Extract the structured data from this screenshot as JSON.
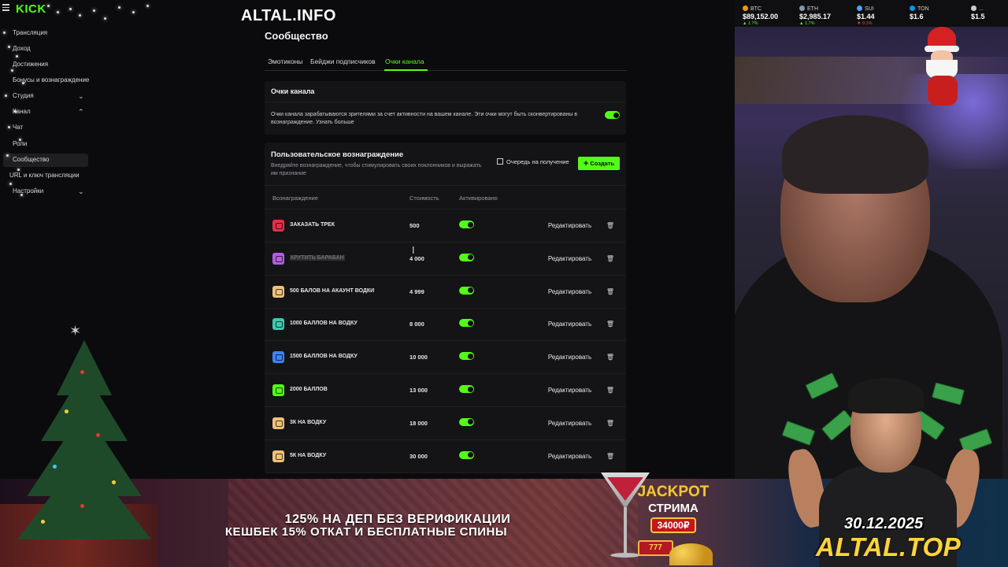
{
  "sidebar": {
    "logo": "KICK",
    "items": [
      {
        "label": "Трансляция"
      },
      {
        "label": "Доход"
      },
      {
        "label": "Достижения"
      },
      {
        "label": "Бонусы и вознаграждение"
      },
      {
        "label": "Студия"
      },
      {
        "label": "Канал"
      },
      {
        "label": "Чат"
      },
      {
        "label": "Роли"
      },
      {
        "label": "Сообщество"
      },
      {
        "label": "URL и ключ трансляции"
      },
      {
        "label": "Настройки"
      }
    ]
  },
  "header": {
    "site": "ALTAL.INFO"
  },
  "page": {
    "title": "Сообщество"
  },
  "tabs": [
    {
      "label": "Эмотиконы"
    },
    {
      "label": "Бейджи подписчиков"
    },
    {
      "label": "Очки канала"
    }
  ],
  "channel_points": {
    "title": "Очки канала",
    "description": "Очки канала зарабатываются зрителями за счет активности на вашем канале. Эти очки могут быть сконвертированы в вознаграждение. Узнать больше",
    "enabled": true
  },
  "rewards": {
    "title": "Пользовательское вознаграждение",
    "subtitle": "Внедряйте вознаграждение, чтобы стимулировать своих поклонников и выражать им признание",
    "queue_label": "Очередь на получение",
    "create_label": "Создать",
    "columns": {
      "reward": "Вознаграждение",
      "cost": "Стоимость",
      "active": "Активировано"
    },
    "edit_label": "Редактировать",
    "delete_glyph": "🗑",
    "items": [
      {
        "name": "ЗАКАЗАТЬ ТРЕК",
        "cost": "500",
        "active": true,
        "color": "#e5304a"
      },
      {
        "name": "КРУТИТЬ БАРАБАН",
        "cost": "4 000",
        "active": true,
        "color": "#b45de0"
      },
      {
        "name": "500 БАЛОВ НА АКАУНТ ВОДКИ",
        "cost": "4 999",
        "active": true,
        "color": "#f0c178"
      },
      {
        "name": "1000 БАЛЛОВ НА ВОДКУ",
        "cost": "8 000",
        "active": true,
        "color": "#3cc9b0"
      },
      {
        "name": "1500 БАЛЛОВ НА ВОДКУ",
        "cost": "10 000",
        "active": true,
        "color": "#3b82f6"
      },
      {
        "name": "2000 БАЛЛОВ",
        "cost": "13 000",
        "active": true,
        "color": "#53fc18"
      },
      {
        "name": "3К НА ВОДКУ",
        "cost": "18 000",
        "active": true,
        "color": "#f0c178"
      },
      {
        "name": "5К НА ВОДКУ",
        "cost": "30 000",
        "active": true,
        "color": "#f0c178"
      }
    ]
  },
  "ticker": [
    {
      "symbol": "BTC",
      "price": "$89,152.00",
      "change": "▲ 1.7%",
      "color": "#f7931a",
      "change_color": "#53fc18"
    },
    {
      "symbol": "ETH",
      "price": "$2,985.17",
      "change": "▲ 1.7%",
      "color": "#8a92b2",
      "change_color": "#53fc18"
    },
    {
      "symbol": "SUI",
      "price": "$1.44",
      "change": "▼ 0.1%",
      "color": "#4da2ff",
      "change_color": "#ff4d4d"
    },
    {
      "symbol": "TON",
      "price": "$1.6",
      "change": "",
      "color": "#0098ea",
      "change_color": "#53fc18"
    },
    {
      "symbol": "...",
      "price": "$1.5",
      "change": "",
      "color": "#cccccc",
      "change_color": "#53fc18"
    }
  ],
  "banner": {
    "line1": "125% НА ДЕП БЕЗ ВЕРИФИКАЦИИ",
    "line2": "КЕШБЕК 15% ОТКАТ И БЕСПЛАТНЫЕ СПИНЫ",
    "jackpot1": "JACKPOT",
    "jackpot2": "СТРИМА",
    "jackpot_amount": "34000₽",
    "slots": "777"
  },
  "promo": {
    "date": "30.12.2025",
    "site": "ALTAL.TOP"
  },
  "colors": {
    "accent": "#53fc18",
    "background": "#0b0b0d",
    "card": "#141417"
  }
}
